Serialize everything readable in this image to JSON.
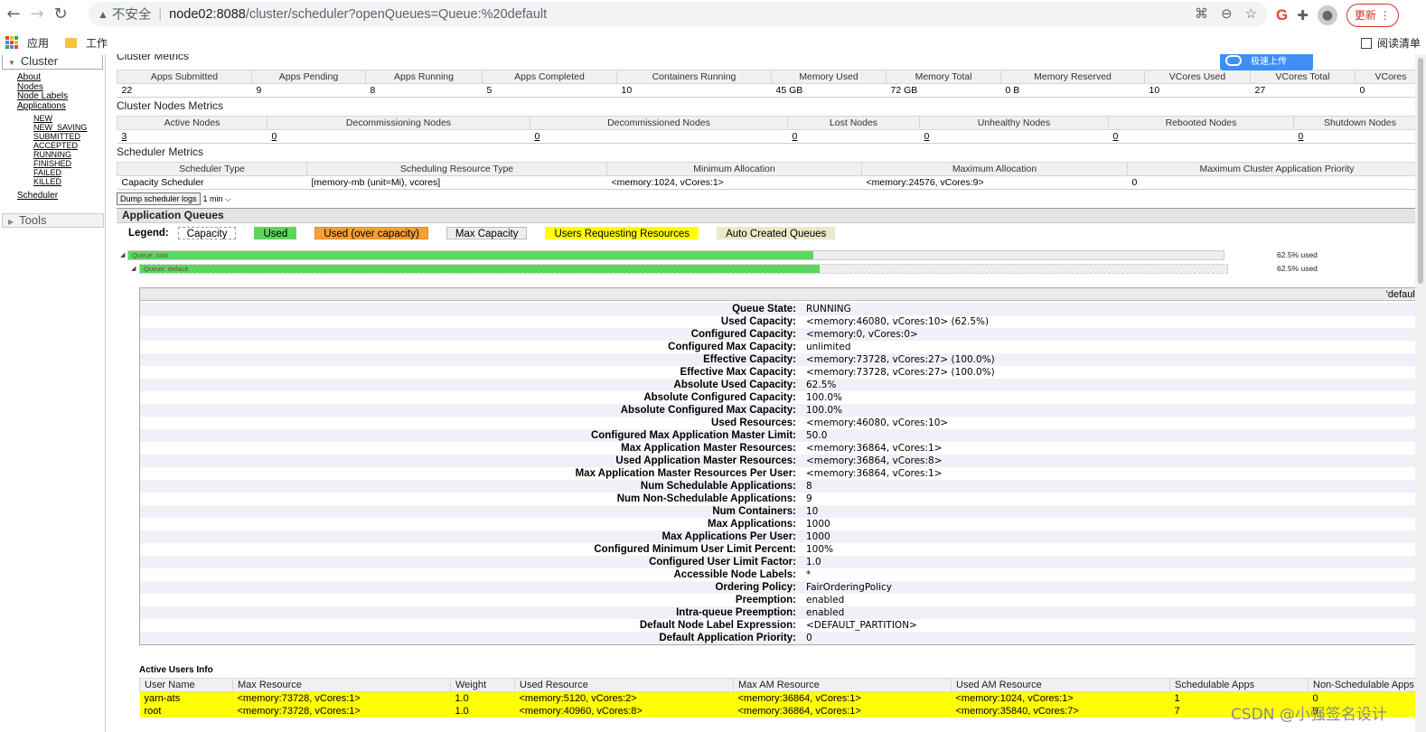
{
  "browser": {
    "insecure_label": "不安全",
    "url_host": "node02:8088",
    "url_path": "/cluster/scheduler?openQueues=Queue:%20default",
    "update_label": "更新",
    "bookmarks": [
      "应用",
      "工作"
    ],
    "reading_list": "阅读清单"
  },
  "sidebar": {
    "cluster_label": "Cluster",
    "links": [
      "About",
      "Nodes",
      "Node Labels",
      "Applications"
    ],
    "app_states": [
      "NEW",
      "NEW_SAVING",
      "SUBMITTED",
      "ACCEPTED",
      "RUNNING",
      "FINISHED",
      "FAILED",
      "KILLED"
    ],
    "scheduler_link": "Scheduler",
    "tools_label": "Tools"
  },
  "cluster_metrics": {
    "title": "Cluster Metrics",
    "headers": [
      "Apps Submitted",
      "Apps Pending",
      "Apps Running",
      "Apps Completed",
      "Containers Running",
      "Memory Used",
      "Memory Total",
      "Memory Reserved",
      "VCores Used",
      "VCores Total",
      "VCores"
    ],
    "values": [
      "22",
      "9",
      "8",
      "5",
      "10",
      "45 GB",
      "72 GB",
      "0 B",
      "10",
      "27",
      "0"
    ]
  },
  "nodes_metrics": {
    "title": "Cluster Nodes Metrics",
    "headers": [
      "Active Nodes",
      "Decommissioning Nodes",
      "Decommissioned Nodes",
      "Lost Nodes",
      "Unhealthy Nodes",
      "Rebooted Nodes",
      "Shutdown Nodes"
    ],
    "values": [
      "3",
      "0",
      "0",
      "0",
      "0",
      "0",
      "0"
    ]
  },
  "scheduler_metrics": {
    "title": "Scheduler Metrics",
    "headers": [
      "Scheduler Type",
      "Scheduling Resource Type",
      "Minimum Allocation",
      "Maximum Allocation",
      "Maximum Cluster Application Priority"
    ],
    "values": [
      "Capacity Scheduler",
      "[memory-mb (unit=Mi), vcores]",
      "<memory:1024, vCores:1>",
      "<memory:24576, vCores:9>",
      "0"
    ]
  },
  "dump": {
    "button": "Dump scheduler logs",
    "interval": "1 min"
  },
  "app_queues": {
    "title": "Application Queues",
    "legend_label": "Legend:",
    "legend": [
      "Capacity",
      "Used",
      "Used (over capacity)",
      "Max Capacity",
      "Users Requesting Resources",
      "Auto Created Queues"
    ],
    "root": {
      "label": "Queue: root",
      "used_fraction": 0.625,
      "pct_text": "62.5% used"
    },
    "default": {
      "label": "Queue: default",
      "used_fraction": 0.625,
      "pct_text": "62.5% used"
    }
  },
  "queue_details": {
    "header": "'default'",
    "rows": [
      {
        "k": "Queue State:",
        "v": "RUNNING"
      },
      {
        "k": "Used Capacity:",
        "v": "<memory:46080, vCores:10> (62.5%)"
      },
      {
        "k": "Configured Capacity:",
        "v": "<memory:0, vCores:0>"
      },
      {
        "k": "Configured Max Capacity:",
        "v": "unlimited"
      },
      {
        "k": "Effective Capacity:",
        "v": "<memory:73728, vCores:27> (100.0%)"
      },
      {
        "k": "Effective Max Capacity:",
        "v": "<memory:73728, vCores:27> (100.0%)"
      },
      {
        "k": "Absolute Used Capacity:",
        "v": "62.5%"
      },
      {
        "k": "Absolute Configured Capacity:",
        "v": "100.0%"
      },
      {
        "k": "Absolute Configured Max Capacity:",
        "v": "100.0%"
      },
      {
        "k": "Used Resources:",
        "v": "<memory:46080, vCores:10>"
      },
      {
        "k": "Configured Max Application Master Limit:",
        "v": "50.0"
      },
      {
        "k": "Max Application Master Resources:",
        "v": "<memory:36864, vCores:1>"
      },
      {
        "k": "Used Application Master Resources:",
        "v": "<memory:36864, vCores:8>"
      },
      {
        "k": "Max Application Master Resources Per User:",
        "v": "<memory:36864, vCores:1>"
      },
      {
        "k": "Num Schedulable Applications:",
        "v": "8"
      },
      {
        "k": "Num Non-Schedulable Applications:",
        "v": "9"
      },
      {
        "k": "Num Containers:",
        "v": "10"
      },
      {
        "k": "Max Applications:",
        "v": "1000"
      },
      {
        "k": "Max Applications Per User:",
        "v": "1000"
      },
      {
        "k": "Configured Minimum User Limit Percent:",
        "v": "100%"
      },
      {
        "k": "Configured User Limit Factor:",
        "v": "1.0"
      },
      {
        "k": "Accessible Node Labels:",
        "v": "*"
      },
      {
        "k": "Ordering Policy:",
        "v": "FairOrderingPolicy"
      },
      {
        "k": "Preemption:",
        "v": "enabled"
      },
      {
        "k": "Intra-queue Preemption:",
        "v": "enabled"
      },
      {
        "k": "Default Node Label Expression:",
        "v": "<DEFAULT_PARTITION>"
      },
      {
        "k": "Default Application Priority:",
        "v": "0"
      }
    ]
  },
  "active_users": {
    "title": "Active Users Info",
    "headers": [
      "User Name",
      "Max Resource",
      "Weight",
      "Used Resource",
      "Max AM Resource",
      "Used AM Resource",
      "Schedulable Apps",
      "Non-Schedulable Apps"
    ],
    "rows": [
      [
        "yarn-ats",
        "<memory:73728, vCores:1>",
        "1.0",
        "<memory:5120, vCores:2>",
        "<memory:36864, vCores:1>",
        "<memory:1024, vCores:1>",
        "1",
        "0"
      ],
      [
        "root",
        "<memory:73728, vCores:1>",
        "1.0",
        "<memory:40960, vCores:8>",
        "<memory:36864, vCores:1>",
        "<memory:35840, vCores:7>",
        "7",
        "9"
      ]
    ]
  },
  "overlay": {
    "baidu_label": "极速上传",
    "watermark": "CSDN @小强签名设计"
  }
}
